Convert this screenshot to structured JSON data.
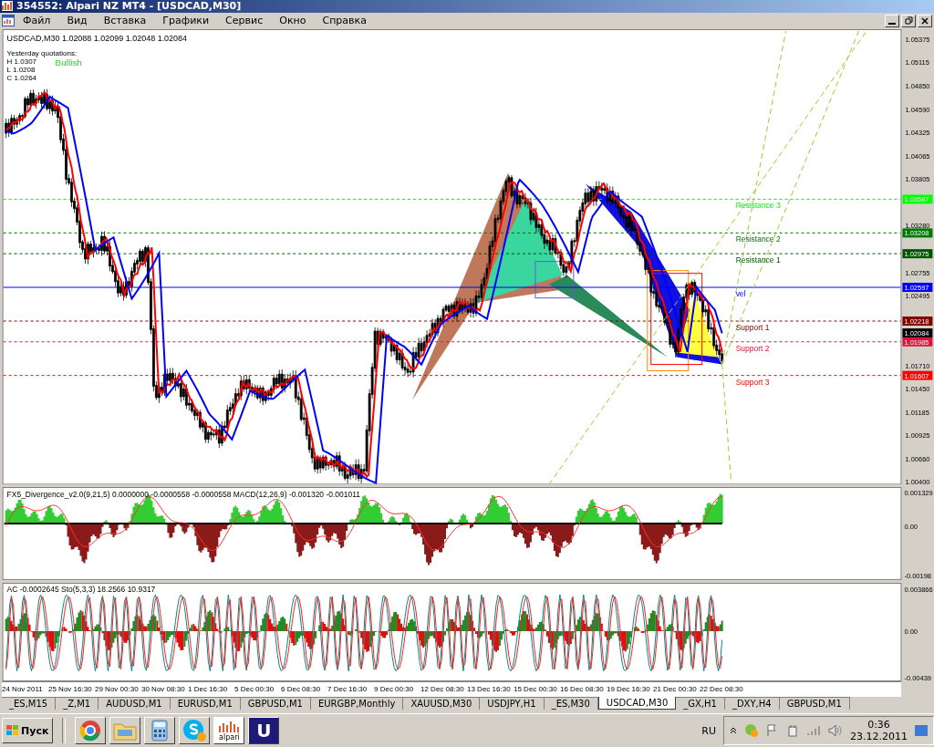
{
  "window": {
    "title": "354552: Alpari NZ MT4 - [USDCAD,M30]"
  },
  "menu": [
    "Файл",
    "Вид",
    "Вставка",
    "Графики",
    "Сервис",
    "Окно",
    "Справка"
  ],
  "main_chart": {
    "header": "USDCAD,M30  1.02088 1.02099 1.02048 1.02084",
    "info": [
      "Yesterday quotations:",
      "H 1.0307",
      "L 1.0208",
      "C 1.0264"
    ],
    "signal": "Bullish",
    "price_ticks": [
      "1.05375",
      "1.05115",
      "1.04850",
      "1.04590",
      "1.04325",
      "1.04065",
      "1.03805",
      "1.03280",
      "1.02755",
      "1.02495",
      "1.01710",
      "1.01450",
      "1.01185",
      "1.00925",
      "1.00660",
      "1.00400"
    ],
    "price_tags": [
      {
        "price": "1.03587",
        "color": "#00ff00",
        "kind": "dashed",
        "label": "Resistance 3"
      },
      {
        "price": "1.03208",
        "color": "#007700",
        "kind": "dashed",
        "label": "Resistance 2"
      },
      {
        "price": "1.02975",
        "color": "#005500",
        "kind": "dashed",
        "label": "Resistance 1"
      },
      {
        "price": "1.02597",
        "color": "#0000ff",
        "kind": "solid",
        "label": "vel"
      },
      {
        "price": "1.02218",
        "color": "#800000",
        "kind": "dashed",
        "label": "Support 1"
      },
      {
        "price": "1.02084",
        "color": "#000000",
        "kind": "plain"
      },
      {
        "price": "1.01985",
        "color": "#dc143c",
        "kind": "dashed",
        "label": "Support 2"
      },
      {
        "price": "1.01607",
        "color": "#ff0000",
        "kind": "dashed",
        "label": "Support 3"
      }
    ]
  },
  "macd_panel": {
    "header": "FX5_Divergence_v2.0(9,21,5) 0.0000000 -0.0000558 -0.0000558  MACD(12,26,9) -0.001320 -0.001011",
    "ticks": [
      "0.001329",
      "0.00",
      "-0.00198"
    ]
  },
  "ac_panel": {
    "header": "AC -0.0002645  Sto(5,3,3) 18.2566 10.9317",
    "ticks": [
      "0.003866",
      "0.00",
      "-0.00439"
    ]
  },
  "time_axis": [
    "24 Nov 2011",
    "25 Nov 16:30",
    "29 Nov 00:30",
    "30 Nov 08:30",
    "1 Dec 16:30",
    "5 Dec 00:30",
    "6 Dec 08:30",
    "7 Dec 16:30",
    "9 Dec 00:30",
    "12 Dec 08:30",
    "13 Dec 16:30",
    "15 Dec 00:30",
    "16 Dec 08:30",
    "19 Dec 16:30",
    "21 Dec 00:30",
    "22 Dec 08:30"
  ],
  "tabs": [
    {
      "label": "_ES,M15",
      "selected": false
    },
    {
      "label": "_Z,M1",
      "selected": false
    },
    {
      "label": "AUDUSD,M1",
      "selected": false
    },
    {
      "label": "EURUSD,M1",
      "selected": false
    },
    {
      "label": "GBPUSD,M1",
      "selected": false
    },
    {
      "label": "EURGBP,Monthly",
      "selected": false
    },
    {
      "label": "XAUUSD,M30",
      "selected": false
    },
    {
      "label": "USDJPY,H1",
      "selected": false
    },
    {
      "label": "_ES,M30",
      "selected": false
    },
    {
      "label": "USDCAD,M30",
      "selected": true
    },
    {
      "label": "_GX,H1",
      "selected": false
    },
    {
      "label": "_DXY,H4",
      "selected": false
    },
    {
      "label": "GBPUSD,M1",
      "selected": false
    }
  ],
  "taskbar": {
    "start": "Пуск",
    "apps": [
      {
        "kind": "browser"
      },
      {
        "kind": "folder"
      },
      {
        "kind": "calculator"
      },
      {
        "kind": "skype"
      },
      {
        "kind": "alpari",
        "text": "alpari"
      },
      {
        "kind": "letter",
        "text": "U"
      }
    ],
    "language": "RU",
    "time": "0:36",
    "date": "23.12.2011"
  }
}
